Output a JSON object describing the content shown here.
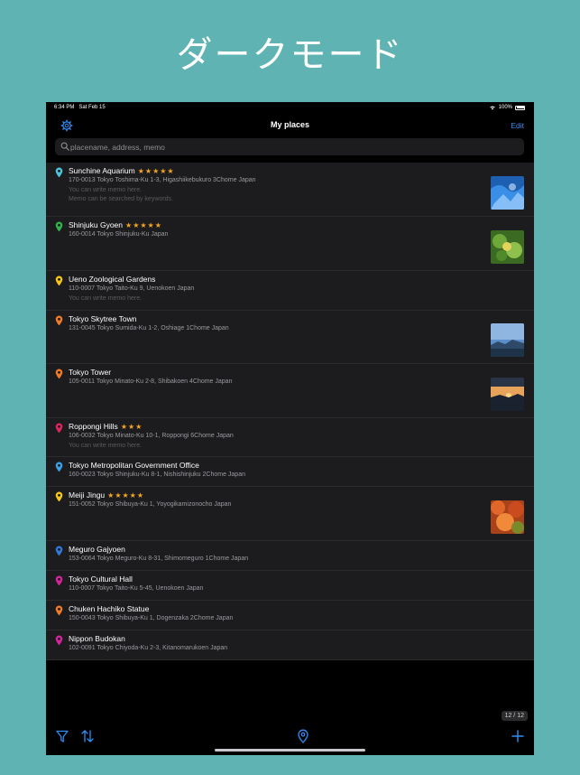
{
  "promo": {
    "title": "ダークモード"
  },
  "status_bar": {
    "time": "6:34 PM",
    "date": "Sat Feb 15",
    "battery": "100%"
  },
  "nav": {
    "title": "My places",
    "edit_label": "Edit"
  },
  "search": {
    "placeholder": "placename, address, memo",
    "value": ""
  },
  "places": [
    {
      "name": "Sunchine Aquarium",
      "stars": "★★★★★",
      "address": "170-0013 Tokyo Toshima-Ku 1-3, Higashiikebukuro 3Chome Japan",
      "memo": [
        "You can write memo here.",
        "Memo can be searched by keywords."
      ],
      "pin_color": "#4fc3d9",
      "thumb": "aquarium"
    },
    {
      "name": "Shinjuku Gyoen",
      "stars": "★★★★★",
      "address": "160-0014 Tokyo Shinjuku-Ku Japan",
      "memo": [],
      "pin_color": "#2fb34a",
      "thumb": "leaves"
    },
    {
      "name": "Ueno Zoological Gardens",
      "stars": "",
      "address": "110-0007 Tokyo Taito-Ku 9, Uenokoen Japan",
      "memo": [
        "You can write memo here."
      ],
      "pin_color": "#f5c518",
      "thumb": ""
    },
    {
      "name": "Tokyo Skytree Town",
      "stars": "",
      "address": "131-0045 Tokyo Sumida-Ku 1-2, Oshiage 1Chome Japan",
      "memo": [],
      "pin_color": "#f07a2a",
      "thumb": "sky"
    },
    {
      "name": "Tokyo Tower",
      "stars": "",
      "address": "105-0011 Tokyo Minato-Ku 2-8, Shibakoen 4Chome Japan",
      "memo": [],
      "pin_color": "#f07a2a",
      "thumb": "sunset"
    },
    {
      "name": "Roppongi Hills",
      "stars": "★★★",
      "address": "106-0032 Tokyo Minato-Ku 10-1, Roppongi 6Chome Japan",
      "memo": [
        "You can write memo here."
      ],
      "pin_color": "#e0245e",
      "thumb": ""
    },
    {
      "name": "Tokyo Metropolitan Government Office",
      "stars": "",
      "address": "160-0023 Tokyo Shinjuku-Ku 8-1, Nishishinjuku 2Chome Japan",
      "memo": [],
      "pin_color": "#3aa0e8",
      "thumb": ""
    },
    {
      "name": "Meiji Jingu",
      "stars": "★★★★★",
      "address": "151-0052 Tokyo Shibuya-Ku 1, Yoyogikamizonocho Japan",
      "memo": [],
      "pin_color": "#f5c518",
      "thumb": "autumn"
    },
    {
      "name": "Meguro Gajyoen",
      "stars": "",
      "address": "153-0064 Tokyo Meguro-Ku 8-31, Shimomeguro 1Chome Japan",
      "memo": [],
      "pin_color": "#2f7ad9",
      "thumb": ""
    },
    {
      "name": "Tokyo Cultural Hall",
      "stars": "",
      "address": "110-0007 Tokyo Taito-Ku 5-45, Uenokoen Japan",
      "memo": [],
      "pin_color": "#d6249f",
      "thumb": ""
    },
    {
      "name": "Chuken Hachiko Statue",
      "stars": "",
      "address": "150-0043 Tokyo Shibuya-Ku 1, Dogenzaka 2Chome Japan",
      "memo": [],
      "pin_color": "#f07a2a",
      "thumb": ""
    },
    {
      "name": "Nippon Budokan",
      "stars": "",
      "address": "102-0091 Tokyo Chiyoda-Ku 2-3, Kitanomarukoen Japan",
      "memo": [],
      "pin_color": "#d6249f",
      "thumb": ""
    }
  ],
  "counter": "12 / 12",
  "colors": {
    "accent": "#2f8ef8",
    "star": "#f5a623",
    "background": "#5fb4b3"
  }
}
